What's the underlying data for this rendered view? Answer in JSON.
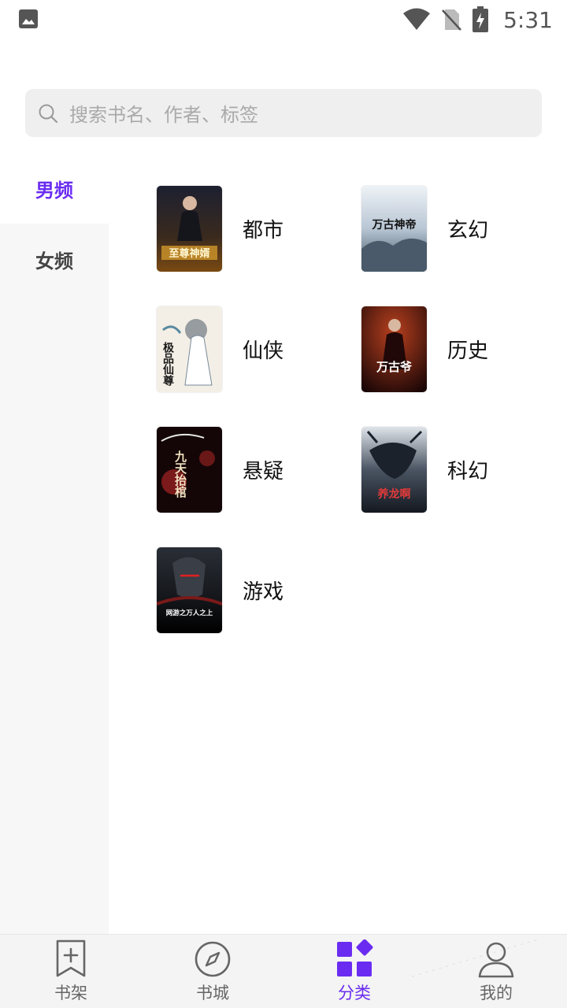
{
  "status_bar": {
    "time": "5:31",
    "icons": [
      "image-icon",
      "wifi-icon",
      "no-sim-icon",
      "battery-charging-icon"
    ]
  },
  "search": {
    "placeholder": "搜索书名、作者、标签"
  },
  "side_nav": {
    "tabs": [
      {
        "label": "男频",
        "active": true
      },
      {
        "label": "女频",
        "active": false
      }
    ]
  },
  "categories": [
    {
      "label": "都市",
      "cover_title": "至尊神婿",
      "cover_colors": [
        "#1d2030",
        "#b8862c"
      ]
    },
    {
      "label": "玄幻",
      "cover_title": "万古神帝",
      "cover_colors": [
        "#dfe6ee",
        "#2d3b4a"
      ]
    },
    {
      "label": "仙侠",
      "cover_title": "极品仙尊",
      "cover_colors": [
        "#f3efe6",
        "#4b6a7a"
      ]
    },
    {
      "label": "历史",
      "cover_title": "万古爷",
      "cover_colors": [
        "#2a0d0a",
        "#b8401f"
      ]
    },
    {
      "label": "悬疑",
      "cover_title": "九天抬棺",
      "cover_colors": [
        "#140606",
        "#c0282a"
      ]
    },
    {
      "label": "科幻",
      "cover_title": "养龙啊",
      "cover_colors": [
        "#1c2230",
        "#6a7a8a"
      ]
    },
    {
      "label": "游戏",
      "cover_title": "网游之万人之上",
      "cover_colors": [
        "#0f1014",
        "#7a1a1a"
      ]
    }
  ],
  "bottom_nav": {
    "items": [
      {
        "label": "书架",
        "icon": "bookmark-icon",
        "active": false
      },
      {
        "label": "书城",
        "icon": "compass-icon",
        "active": false
      },
      {
        "label": "分类",
        "icon": "category-icon",
        "active": true
      },
      {
        "label": "我的",
        "icon": "profile-icon",
        "active": false
      }
    ]
  },
  "colors": {
    "accent": "#6a2cf1",
    "nav_bg": "#f4f4f4",
    "side_bg": "#f7f7f7",
    "search_bg": "#efefef"
  }
}
